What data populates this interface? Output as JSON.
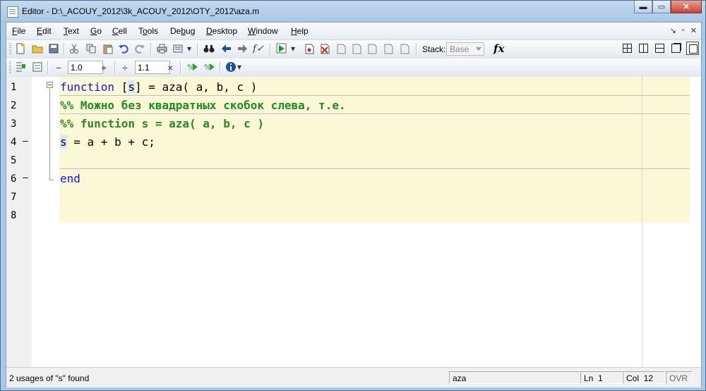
{
  "window": {
    "title": "Editor - D:\\_ACOUY_2012\\3k_ACOUY_2012\\OTY_2012\\aza.m",
    "minimize": "▬",
    "maximize": "▭",
    "close": "✕"
  },
  "menu": {
    "items": [
      {
        "prefix": "",
        "u": "F",
        "rest": "ile"
      },
      {
        "prefix": "",
        "u": "E",
        "rest": "dit"
      },
      {
        "prefix": "",
        "u": "T",
        "rest": "ext"
      },
      {
        "prefix": "",
        "u": "G",
        "rest": "o"
      },
      {
        "prefix": "",
        "u": "C",
        "rest": "ell"
      },
      {
        "prefix": "T",
        "u": "o",
        "rest": "ols"
      },
      {
        "prefix": "De",
        "u": "b",
        "rest": "ug"
      },
      {
        "prefix": "",
        "u": "D",
        "rest": "esktop"
      },
      {
        "prefix": "",
        "u": "W",
        "rest": "indow"
      },
      {
        "prefix": "",
        "u": "H",
        "rest": "elp"
      }
    ],
    "right_icons": [
      "↘",
      "▫",
      "✕"
    ]
  },
  "toolbar": {
    "stack_label": "Stack:",
    "stack_value": "Base",
    "fx_label": "fx"
  },
  "cell_toolbar": {
    "minus": "−",
    "value1": "1.0",
    "plus": "+",
    "divide": "÷",
    "value2": "1.1",
    "times": "×"
  },
  "editor": {
    "line_numbers": [
      "1",
      "2",
      "3",
      "4",
      "5",
      "6",
      "7",
      "8"
    ],
    "lines": {
      "l1_kw": "function",
      "l1_a": " [",
      "l1_s": "s",
      "l1_b": "] = aza( a, b, c )",
      "l2": "%% Можно без квадратных скобок слева, т.е.",
      "l3": "%% function s = aza( a, b, c )",
      "l4_s": "s",
      "l4_rest": " = a + b + c;",
      "l6": "end"
    },
    "dash": "—"
  },
  "status": {
    "message": "2 usages of \"s\" found",
    "function_name": "aza",
    "ln_label": "Ln",
    "ln_value": "1",
    "col_label": "Col",
    "col_value": "12",
    "ovr": "OVR"
  }
}
